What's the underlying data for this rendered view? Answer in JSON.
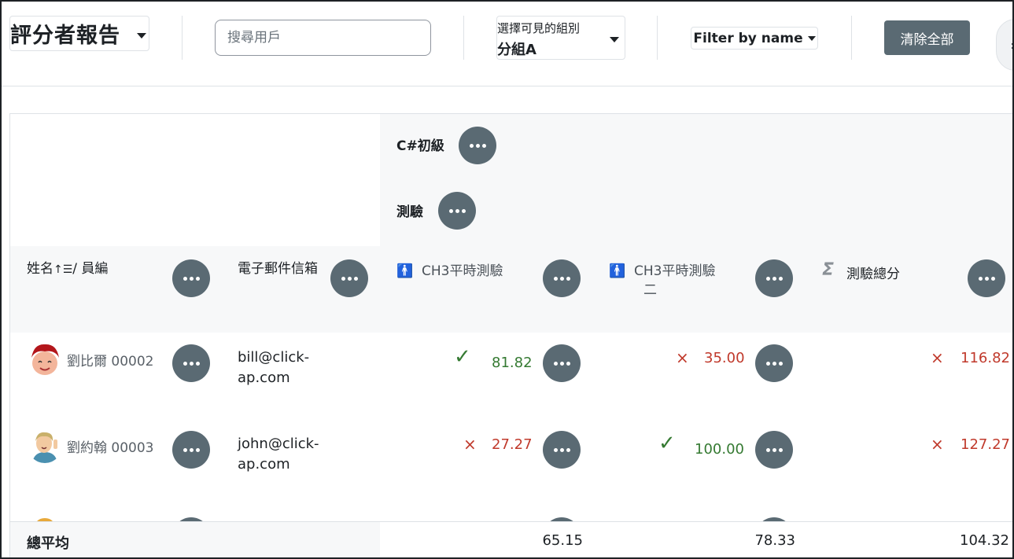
{
  "header": {
    "report_title": "評分者報告",
    "search_placeholder": "搜尋用戶",
    "group_label": "選擇可見的組別",
    "group_value": "分組A",
    "filter_label": "Filter by name",
    "clear_label": "清除全部"
  },
  "grid": {
    "category": "C#初級",
    "subcategory": "測驗",
    "columns": {
      "name": "姓名",
      "name_sep": "/ 員編",
      "email": "電子郵件信箱",
      "item1": "CH3平時測驗",
      "item2_line1": "CH3平時測驗",
      "item2_line2": "二",
      "total": "測驗總分"
    },
    "rows": [
      {
        "name": "劉比爾 00002",
        "email_line1": "bill@click-",
        "email_line2": "ap.com",
        "item1": "81.82",
        "item1_status": "pass",
        "item2": "35.00",
        "item2_status": "fail",
        "total": "116.82",
        "total_status": "fail"
      },
      {
        "name": "劉約翰 00003",
        "email_line1": "john@click-",
        "email_line2": "ap.com",
        "item1": "27.27",
        "item1_status": "fail",
        "item2": "100.00",
        "item2_status": "pass",
        "total": "127.27",
        "total_status": "fail"
      }
    ],
    "averages": {
      "label": "總平均",
      "item1": "65.15",
      "item2": "78.33",
      "total": "104.32"
    }
  },
  "colors": {
    "primary": "#5a6a73",
    "pass": "#357a32",
    "fail": "#c0392b",
    "header_bg": "#f7f8f9"
  },
  "icons": {
    "check": "check-icon",
    "cross": "cross-icon",
    "sort": "sort-ascending-icon",
    "person": "manual-item-icon",
    "sigma": "sum-icon"
  }
}
